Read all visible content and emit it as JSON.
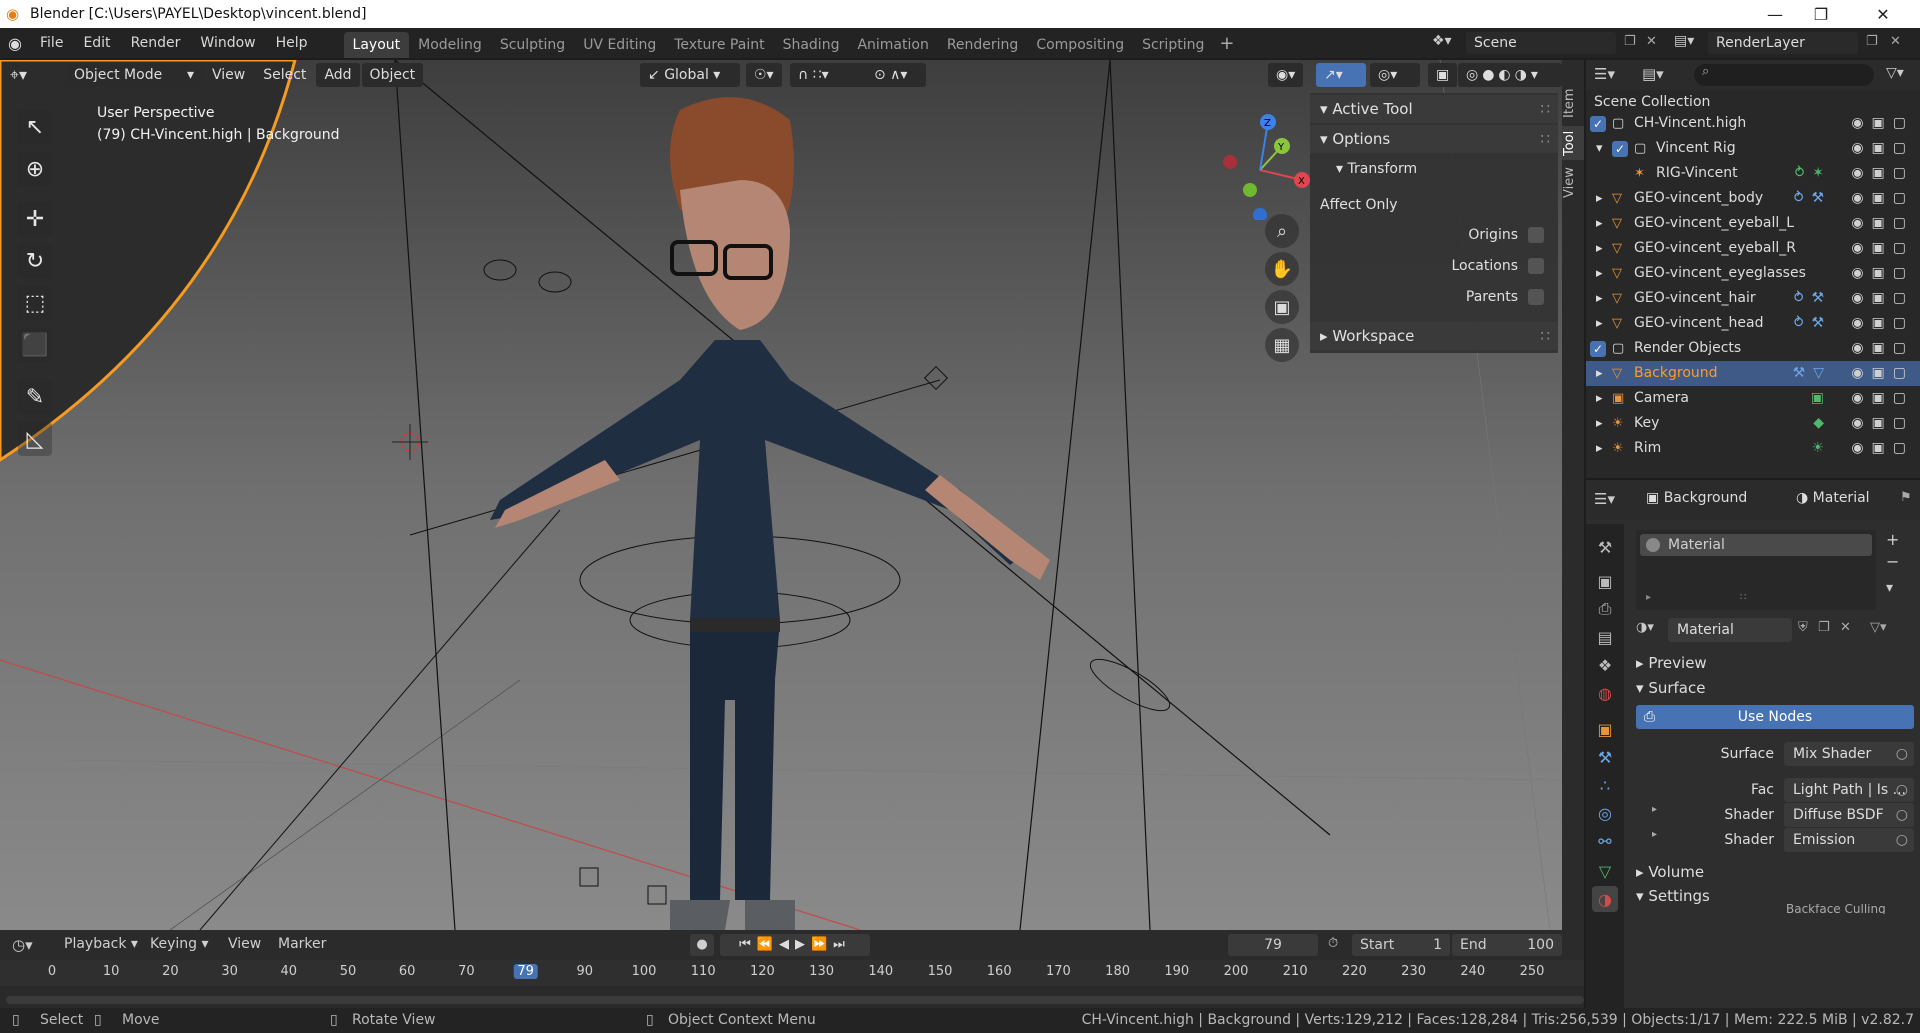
{
  "window": {
    "title": "Blender [C:\\Users\\PAYEL\\Desktop\\vincent.blend]",
    "min_icon": "minimize-icon",
    "max_icon": "maximize-icon",
    "close_icon": "close-icon"
  },
  "menu": [
    "File",
    "Edit",
    "Render",
    "Window",
    "Help"
  ],
  "workspaces": [
    "Layout",
    "Modeling",
    "Sculpting",
    "UV Editing",
    "Texture Paint",
    "Shading",
    "Animation",
    "Rendering",
    "Compositing",
    "Scripting"
  ],
  "active_workspace": "Layout",
  "scene": {
    "label": "Scene"
  },
  "view_layer": {
    "label": "RenderLayer"
  },
  "viewport": {
    "mode": "Object Mode",
    "menus": [
      "View",
      "Select",
      "Add",
      "Object"
    ],
    "orientation": "Global",
    "perspective_label": "User Perspective",
    "object_info": "(79) CH-Vincent.high | Background",
    "gizmo_axes": {
      "x": "X",
      "y": "Y",
      "z": "Z"
    },
    "colors": {
      "x": "#e0464f",
      "y": "#8bc43f",
      "z": "#3b82e6"
    }
  },
  "npanel": {
    "tabs": [
      "Item",
      "Tool",
      "View"
    ],
    "active_tool": "Active Tool",
    "options": "Options",
    "transform": "Transform",
    "affect_only": "Affect Only",
    "checks": [
      "Origins",
      "Locations",
      "Parents"
    ],
    "workspace": "Workspace"
  },
  "outliner": {
    "header": "Scene Collection",
    "rows": [
      {
        "label": "CH-Vincent.high",
        "type": "collection",
        "checked": true
      },
      {
        "label": "Vincent Rig",
        "type": "collection",
        "checked": true
      },
      {
        "label": "RIG-Vincent",
        "type": "armature"
      },
      {
        "label": "GEO-vincent_body",
        "type": "mesh"
      },
      {
        "label": "GEO-vincent_eyeball_L",
        "type": "mesh"
      },
      {
        "label": "GEO-vincent_eyeball_R",
        "type": "mesh"
      },
      {
        "label": "GEO-vincent_eyeglasses",
        "type": "mesh"
      },
      {
        "label": "GEO-vincent_hair",
        "type": "mesh"
      },
      {
        "label": "GEO-vincent_head",
        "type": "mesh"
      },
      {
        "label": "Render Objects",
        "type": "collection",
        "checked": true
      },
      {
        "label": "Background",
        "type": "mesh",
        "selected": true
      },
      {
        "label": "Camera",
        "type": "camera"
      },
      {
        "label": "Key",
        "type": "light"
      },
      {
        "label": "Rim",
        "type": "light"
      }
    ]
  },
  "properties": {
    "object": "Background",
    "data_tab": "Material",
    "slot": "Material",
    "material_name": "Material",
    "sections": {
      "preview": "Preview",
      "surface": "Surface",
      "volume": "Volume",
      "settings": "Settings"
    },
    "use_nodes": "Use Nodes",
    "surface_label": "Surface",
    "surface_value": "Mix Shader",
    "fac_label": "Fac",
    "fac_value": "Light Path | Is ...",
    "shader1_label": "Shader",
    "shader1_value": "Diffuse BSDF",
    "shader2_label": "Shader",
    "shader2_value": "Emission",
    "cutoff_text": "Backface Culling"
  },
  "timeline": {
    "menus": [
      "Playback",
      "Keying",
      "View",
      "Marker"
    ],
    "current_frame": "79",
    "start_label": "Start",
    "start": "1",
    "end_label": "End",
    "end": "100",
    "ruler": [
      "0",
      "10",
      "20",
      "30",
      "40",
      "50",
      "60",
      "70",
      "79",
      "90",
      "100",
      "110",
      "120",
      "130",
      "140",
      "150",
      "160",
      "170",
      "180",
      "190",
      "200",
      "210",
      "220",
      "230",
      "240",
      "250"
    ]
  },
  "status": {
    "select": "Select",
    "move": "Move",
    "rotate": "Rotate View",
    "context": "Object Context Menu",
    "stats": "CH-Vincent.high | Background | Verts:129,212 | Faces:128,284 | Tris:256,539 | Objects:1/17 | Mem: 222.5 MiB | v2.82.7"
  }
}
